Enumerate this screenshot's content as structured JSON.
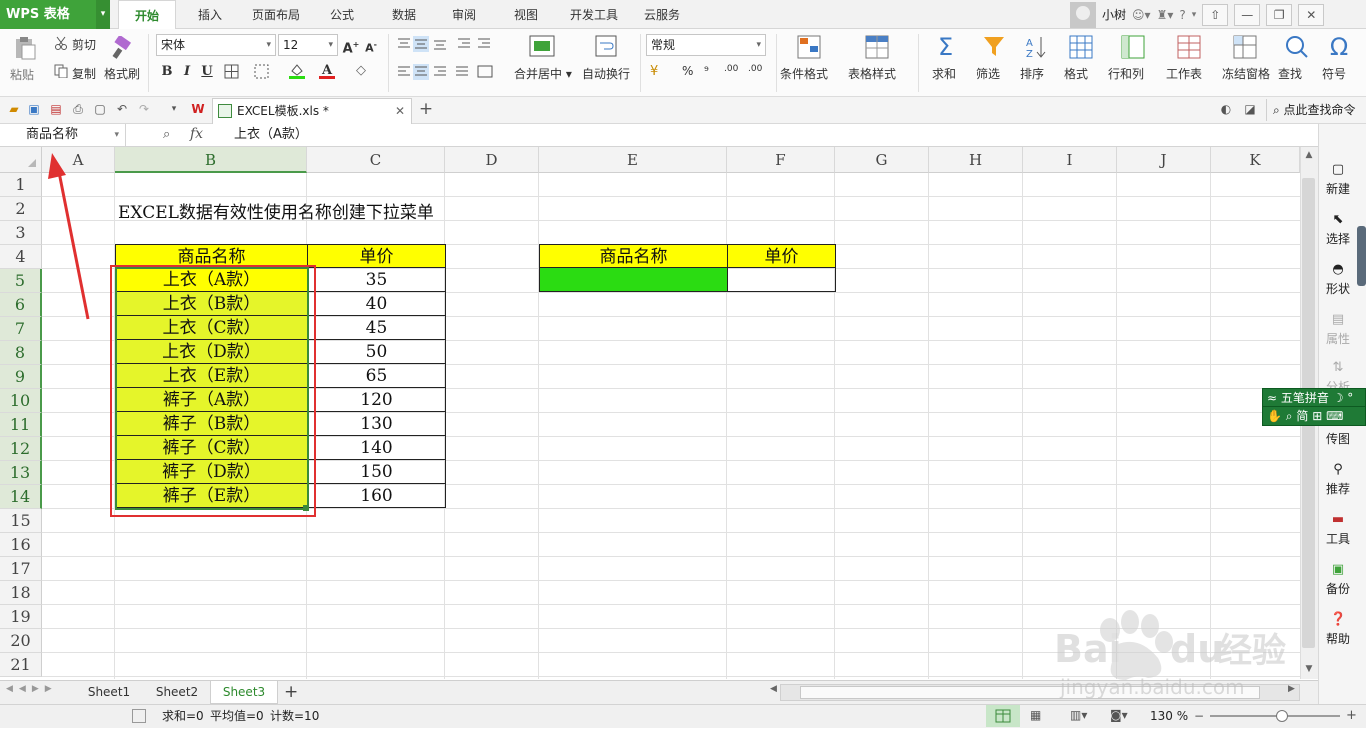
{
  "app": {
    "logo": "WPS 表格",
    "user": "小树",
    "help": "?"
  },
  "menu": [
    "开始",
    "插入",
    "页面布局",
    "公式",
    "数据",
    "审阅",
    "视图",
    "开发工具",
    "云服务"
  ],
  "ribbon": {
    "paste": "粘贴",
    "cut": "剪切",
    "copy": "复制",
    "format_painter": "格式刷",
    "font_name": "宋体",
    "font_size": "12",
    "merge_center": "合并居中",
    "wrap_text": "自动换行",
    "number_format": "常规",
    "percent": "%",
    "comma": "⁹",
    "dec_inc": ".00",
    "cond_format": "条件格式",
    "table_style": "表格样式",
    "sum": "求和",
    "filter": "筛选",
    "sort": "排序",
    "format": "格式",
    "row_col": "行和列",
    "worksheet": "工作表",
    "freeze": "冻结窗格",
    "find": "查找",
    "symbol": "符号"
  },
  "quickbar": {
    "doc_tab": "EXCEL模板.xls *",
    "find_command": "点此查找命令"
  },
  "formula_bar": {
    "name_box": "商品名称",
    "fx": "fx",
    "value": "上衣（A款）"
  },
  "columns": [
    "A",
    "B",
    "C",
    "D",
    "E",
    "F",
    "G",
    "H",
    "I",
    "J",
    "K"
  ],
  "rows": [
    "1",
    "2",
    "3",
    "4",
    "5",
    "6",
    "7",
    "8",
    "9",
    "10",
    "11",
    "12",
    "13",
    "14",
    "15",
    "16",
    "17",
    "18",
    "19",
    "20",
    "21"
  ],
  "sheet": {
    "title": "EXCEL数据有效性使用名称创建下拉菜单",
    "table1_headers": [
      "商品名称",
      "单价"
    ],
    "table1_rows": [
      [
        "上衣（A款）",
        "35"
      ],
      [
        "上衣（B款）",
        "40"
      ],
      [
        "上衣（C款）",
        "45"
      ],
      [
        "上衣（D款）",
        "50"
      ],
      [
        "上衣（E款）",
        "65"
      ],
      [
        "裤子（A款）",
        "120"
      ],
      [
        "裤子（B款）",
        "130"
      ],
      [
        "裤子（C款）",
        "140"
      ],
      [
        "裤子（D款）",
        "150"
      ],
      [
        "裤子（E款）",
        "160"
      ]
    ],
    "table2_headers": [
      "商品名称",
      "单价"
    ]
  },
  "sidebar": [
    "新建",
    "选择",
    "形状",
    "属性",
    "分析",
    "传图",
    "推荐",
    "工具",
    "备份",
    "帮助"
  ],
  "ime": {
    "line1": "五笔拼音",
    "line2": "简"
  },
  "sheet_tabs": [
    "Sheet1",
    "Sheet2",
    "Sheet3"
  ],
  "status": {
    "sum": "求和=0",
    "avg": "平均值=0",
    "count": "计数=10",
    "zoom": "130 %"
  },
  "watermark": {
    "brand": "Bai du 经验",
    "url": "jingyan.baidu.com"
  },
  "colors": {
    "header_yellow": "#ffff00",
    "name_fill": "#e5f52a",
    "green_cell": "#2bdc12",
    "highlight_red": "#e03030",
    "wps_green": "#3fa33a"
  }
}
